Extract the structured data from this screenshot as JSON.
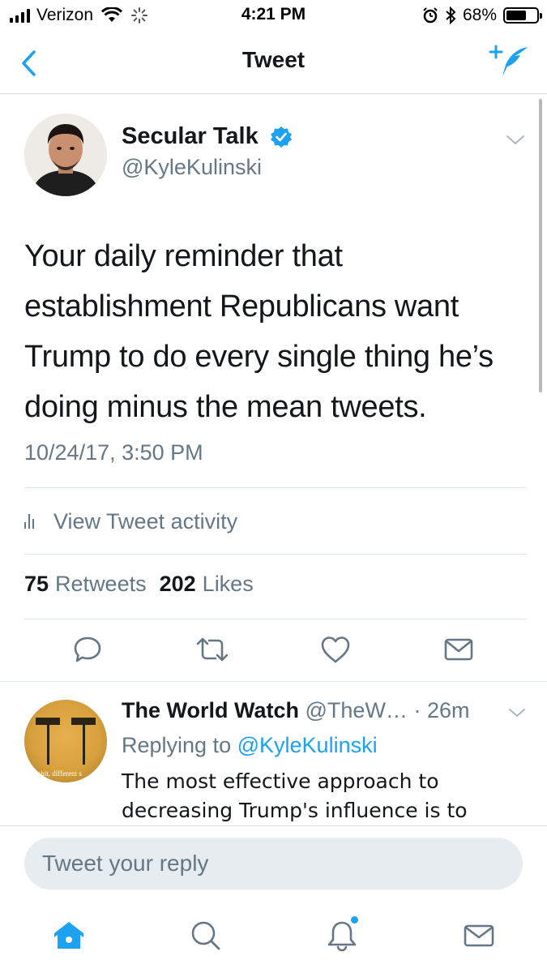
{
  "status_bar": {
    "carrier": "Verizon",
    "time": "4:21 PM",
    "battery_percent": "68%",
    "battery_level": 0.68,
    "icons": [
      "signal-bars-icon",
      "wifi-icon",
      "loading-spinner-icon",
      "alarm-icon",
      "bluetooth-icon",
      "battery-icon"
    ]
  },
  "nav": {
    "title": "Tweet",
    "back_icon": "chevron-left-icon",
    "compose_icon": "compose-tweet-icon"
  },
  "tweet": {
    "author_name": "Secular Talk",
    "author_handle": "@KyleKulinski",
    "verified": true,
    "text": "Your daily reminder that establishment Republicans want Trump to do every single thing he’s doing minus the mean tweets.",
    "timestamp": "10/24/17, 3:50 PM",
    "activity_label": "View Tweet activity",
    "retweets_count": "75",
    "retweets_label": "Retweets",
    "likes_count": "202",
    "likes_label": "Likes",
    "actions": [
      "reply-icon",
      "retweet-icon",
      "like-heart-icon",
      "direct-message-icon"
    ]
  },
  "reply": {
    "author_name": "The World Watch",
    "author_handle": "@TheW…",
    "separator": " · ",
    "time_ago": "26m",
    "replying_label": "Replying to",
    "replying_to": "@KyleKulinski",
    "text": "The most effective approach to decreasing Trump's influence is to",
    "avatar_caption": "ne shit, different s"
  },
  "composer": {
    "placeholder": "Tweet your reply"
  },
  "tab_bar": {
    "tabs": [
      "home-icon",
      "search-icon",
      "notifications-bell-icon",
      "messages-envelope-icon"
    ],
    "active": "home-icon"
  },
  "colors": {
    "accent": "#1da1f2",
    "text": "#14171a",
    "secondary": "#657786",
    "divider": "#e1e8ed",
    "input_background": "#e6ecf0"
  }
}
